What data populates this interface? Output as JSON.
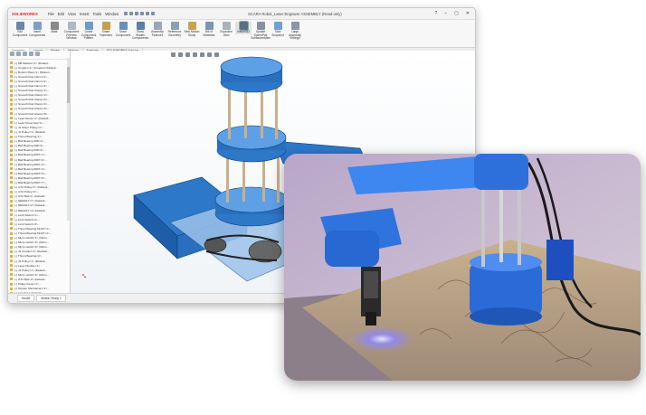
{
  "app": {
    "brand": "SOLIDWORKS",
    "menus": [
      "File",
      "Edit",
      "View",
      "Insert",
      "Tools",
      "Window"
    ],
    "document_title": "SCARA Robot_Laser Engraver ASSEMBLY (Read-only)",
    "window_controls": [
      "?",
      "–",
      "▢",
      "✕"
    ]
  },
  "ribbon": {
    "buttons": [
      {
        "label": "Edit Component",
        "color": "#6b86a8"
      },
      {
        "label": "Insert Components",
        "color": "#7aa0c8"
      },
      {
        "label": "Mate",
        "color": "#8a8a8a"
      },
      {
        "label": "Component Preview Window",
        "color": "#b0b8c2"
      },
      {
        "label": "Linear Component Pattern",
        "color": "#6d9bd1"
      },
      {
        "label": "Smart Fasteners",
        "color": "#c4a04a"
      },
      {
        "label": "Move Component",
        "color": "#6a8fbf"
      },
      {
        "label": "Show Hidden Components",
        "color": "#5d7ea6"
      },
      {
        "label": "Assembly Features",
        "color": "#9aa7b5"
      },
      {
        "label": "Reference Geometry",
        "color": "#8aa0b8"
      },
      {
        "label": "New Motion Study",
        "color": "#c9a44e"
      },
      {
        "label": "Bill of Materials",
        "color": "#7b95b3"
      },
      {
        "label": "Exploded View",
        "color": "#a9b3bf"
      },
      {
        "label": "Instant3D",
        "color": "#5a6e86",
        "active": true
      },
      {
        "label": "Update SpeedPak Subassemblies",
        "color": "#8592a3"
      },
      {
        "label": "Take Snapshot",
        "color": "#6fa0d6"
      },
      {
        "label": "Large Assembly Settings",
        "color": "#8b96a3"
      }
    ]
  },
  "command_tabs": [
    "Assembly",
    "Layout",
    "Sketch",
    "Markup",
    "Evaluate",
    "SOLIDWORKS Add-Ins"
  ],
  "tree": {
    "rows": [
      "(-) M8 Washer<1> (Default...",
      "(-) Coupler<1> (Coupler)<Default...",
      "(-) Bottom Plate<1> (Bottom...",
      "(-) Smooth Rod 10mm<1>...",
      "(-) Smooth Rod 10mm<2>...",
      "(-) Smooth Rod 10mm<3>...",
      "(-) Smooth Rod Clamp<1>...",
      "(-) Smooth Rod Clamp<2>...",
      "(-) Smooth Rod Clamp<3>...",
      "(-) Smooth Rod Clamp<4>...",
      "(-) Smooth Rod Clamp<5>...",
      "(-) Smooth Rod Clamp<6>...",
      "(-) Lead Screw<1> (Default...",
      "(-) Lead Screw Nut<1>...",
      "(-) J1 Motor Pulley<1>...",
      "(-) J1 Pulley<1> (Default...",
      "(-) Thrust Bearing<1>...",
      "(-) Ball Bearing 608<1>...",
      "(-) Ball Bearing 608<2>...",
      "(-) Ball Bearing 608<3>...",
      "(-) Ball Bearing 6807<1>...",
      "(-) Ball Bearing 6807<2>...",
      "(-) Ball Bearing 6807<3>...",
      "(-) Ball Bearing 6807<4>...",
      "(-) Ball Bearing 6807<5>...",
      "(-) Ball Bearing 6807<6>...",
      "(-) Ball Bearing 6807<7>...",
      "(-) GT2 Pulley<1> (Default...",
      "(-) GT2 Pulley<2>...",
      "(-) GT2 Belt<1> (Default...",
      "(-) NEMA17<1> (Default...",
      "(-) NEMA17<2> (Default...",
      "(-) NEMA17<3> (Default...",
      "(-) Limit Switch<1>...",
      "(-) Limit Switch<2>...",
      "(-) Limit Switch<3>...",
      "(-) Thrust Bearing 51107<1>...",
      "(-) Thrust Bearing 51107<2>...",
      "(-) Micro switch<1> (Micro...",
      "(-) Micro switch<2> (Micro...",
      "(-) Micro switch<3> (Micro...",
      "(-) J2 Coupler<1> (Default...",
      "(-) Thrust Bearing<2>...",
      "(-) J3 Pulley<1> (Default...",
      "(-) Laser Module<1>...",
      "(-) J4 Pulley<1> (Default...",
      "(-) Micro switch<4> (Micro...",
      "(-) GT2 Belt<2> (Default...",
      "(-) Pulley Cover<1>...",
      "(-) Gripper Mechanism<1>...",
      "(-) Link 3<1> (Default..."
    ]
  },
  "bottom_tabs": [
    "Model",
    "Motion Study 1"
  ]
}
